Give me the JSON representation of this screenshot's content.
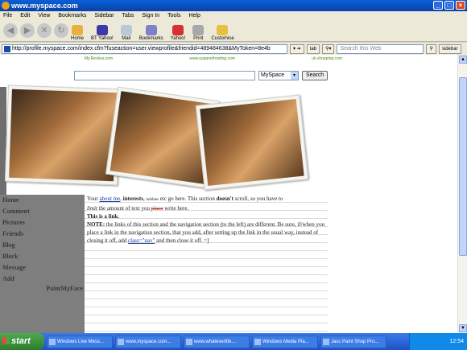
{
  "window": {
    "title": "www.myspace.com"
  },
  "menu": [
    "File",
    "Edit",
    "View",
    "Bookmarks",
    "Sidebar",
    "Tabs",
    "Sign In",
    "Tools",
    "Help"
  ],
  "toolbar": {
    "items": [
      {
        "label": "Home",
        "icon": "home-icon",
        "color": "#e8b040"
      },
      {
        "label": "BT Yahoo!",
        "icon": "bt-yahoo-icon",
        "color": "#3a3aa8"
      },
      {
        "label": "Mail",
        "icon": "mail-icon",
        "color": "#b8c8d8"
      },
      {
        "label": "Bookmarks",
        "icon": "bookmarks-icon",
        "color": "#8080c8"
      },
      {
        "label": "Yahoo!",
        "icon": "yahoo-icon",
        "color": "#d83030"
      },
      {
        "label": "Print",
        "icon": "print-icon",
        "color": "#a8a8a8"
      },
      {
        "label": "Customise",
        "icon": "customise-icon",
        "color": "#e8c040"
      }
    ]
  },
  "address": {
    "url": "http://profile.myspace.com/index.cfm?fuseaction=user.viewprofile&friendid=489484638&MyToken=8e4b",
    "tab_button": "tab",
    "search_placeholder": "Search this Web",
    "sidebar_button": "sidebar"
  },
  "page": {
    "ads": [
      "My.Rexkus.com",
      "www.supanethosting.com",
      "uk.shopping.com"
    ],
    "search_select": "MySpace",
    "search_button": "Search",
    "nav": [
      "Home",
      "Comment",
      "Pictures",
      "Friends",
      "Blog",
      "Block",
      "Message",
      "Add"
    ],
    "nav_footer": "PaintMyFace",
    "body": {
      "p1_a": "Your",
      "about_me": "about me",
      "sep": ",",
      "interests": "interests",
      "hobbies": "hobbies",
      "p1_b": "etc go here. This section",
      "doesnt": "doesn't",
      "p1_c": "scroll, so you have to",
      "limit": "limit",
      "p1_d": "the amount of text you",
      "place": "place",
      "p1_e": "write here.",
      "link_line": "This is a link.",
      "note_label": "NOTE:",
      "note_text": "the links of this section and the navigation section (to the left) are different. Be sure, if/when you place a link in the navigation section, that you add, after setting up the link in the usual way, instead of closing it off, add",
      "class_nav": "class=\"nav\"",
      "note_end": "and then close it off. =]"
    }
  },
  "taskbar": {
    "start": "start",
    "tasks": [
      "Windows Live Mess...",
      "www.myspace.com...",
      "www.whateverlife....",
      "Windows Media Pla...",
      "Jasc Paint Shop Pro..."
    ],
    "clock": "12:54"
  }
}
